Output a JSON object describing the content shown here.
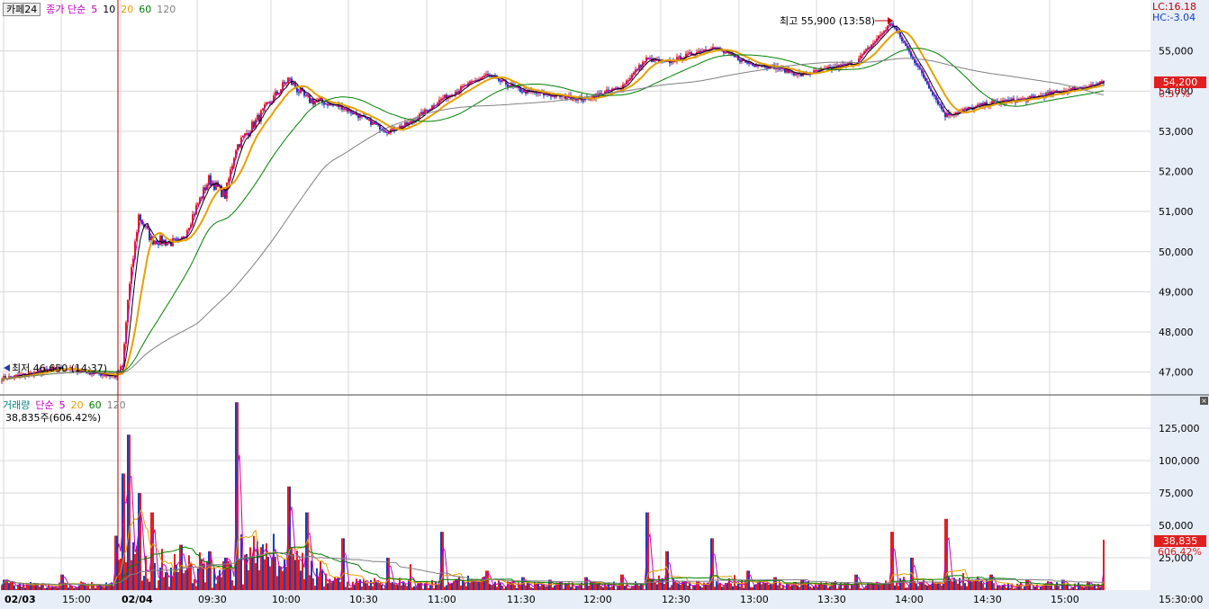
{
  "price_pane": {
    "symbol_tag": "카페24",
    "legend_prefix": "종가 단순",
    "ma_periods": [
      "5",
      "10",
      "20",
      "60",
      "120"
    ],
    "ma_colors": [
      "#c000c0",
      "#000000",
      "#e6a000",
      "#008000",
      "#808080"
    ],
    "lc_label": "LC:16.18",
    "hc_label": "HC:-3.04",
    "current_price": "54,200",
    "current_change": "0.37%",
    "high_annotation": "최고 55,900 (13:58)",
    "low_annotation": "최저 46,650 (14:37)"
  },
  "volume_pane": {
    "title": "거래량",
    "legend_prefix": "단순",
    "ma_periods": [
      "5",
      "20",
      "60",
      "120"
    ],
    "ma_colors": [
      "#c000c0",
      "#e6a000",
      "#008000",
      "#808080"
    ],
    "current_info": "38,835주(606.42%)",
    "current_volume": "38,835",
    "current_ratio": "606.42%",
    "close_icon": "close-icon"
  },
  "colors": {
    "up": "#e02020",
    "down": "#1040c0",
    "grid": "#d8d8d8",
    "axis_bg": "#e8eef8",
    "divider": "#b00000"
  },
  "x_axis": {
    "labels": [
      "02/03",
      "15:00",
      "02/04",
      "09:30",
      "10:00",
      "10:30",
      "11:00",
      "11:30",
      "12:00",
      "12:30",
      "13:00",
      "13:30",
      "14:00",
      "14:30",
      "15:00"
    ],
    "end_label": "15:30:00"
  },
  "chart_data": [
    {
      "type": "line",
      "description_series": "candlestick",
      "x": [
        "14:37",
        "15:00",
        "15:30",
        "09:00",
        "09:05",
        "09:10",
        "09:15",
        "09:20",
        "09:30",
        "09:40",
        "09:50",
        "10:00",
        "10:05",
        "10:15",
        "10:30",
        "10:45",
        "11:00",
        "11:15",
        "11:30",
        "11:45",
        "12:00",
        "12:15",
        "12:25",
        "12:35",
        "12:45",
        "13:00",
        "13:15",
        "13:30",
        "13:45",
        "13:58",
        "14:05",
        "14:15",
        "14:30",
        "14:45",
        "15:00",
        "15:20"
      ],
      "series": [
        {
          "name": "종가",
          "values": [
            46850,
            47100,
            46900,
            47100,
            48800,
            50900,
            50300,
            50200,
            51800,
            51400,
            52600,
            54300,
            53800,
            53600,
            53000,
            53200,
            53800,
            54400,
            54000,
            53900,
            53800,
            54100,
            54800,
            54700,
            55100,
            54700,
            54600,
            54400,
            54700,
            55700,
            54900,
            53400,
            53700,
            53800,
            54000,
            54200
          ]
        }
      ],
      "ylim": [
        46500,
        56200
      ],
      "y_ticks": [
        47000,
        48000,
        49000,
        50000,
        51000,
        52000,
        53000,
        54000,
        55000
      ]
    },
    {
      "type": "bar",
      "x": [
        "14:37",
        "15:00",
        "15:30",
        "09:00",
        "09:05",
        "09:10",
        "09:15",
        "09:20",
        "09:30",
        "09:40",
        "09:50",
        "10:00",
        "10:05",
        "10:15",
        "10:30",
        "10:45",
        "11:00",
        "11:15",
        "11:30",
        "11:45",
        "12:00",
        "12:15",
        "12:25",
        "12:35",
        "12:45",
        "13:00",
        "13:15",
        "13:30",
        "13:45",
        "13:58",
        "14:05",
        "14:15",
        "14:30",
        "14:45",
        "15:00",
        "15:20"
      ],
      "series": [
        {
          "name": "거래량",
          "values": [
            8000,
            12000,
            42000,
            90000,
            120000,
            75000,
            60000,
            35000,
            30000,
            25000,
            145000,
            80000,
            60000,
            40000,
            25000,
            20000,
            45000,
            15000,
            10000,
            8000,
            10000,
            12000,
            60000,
            30000,
            40000,
            15000,
            10000,
            8000,
            12000,
            45000,
            25000,
            55000,
            12000,
            8000,
            8000,
            38835
          ]
        }
      ],
      "ylim": [
        0,
        150000
      ],
      "y_ticks": [
        25000,
        50000,
        75000,
        100000,
        125000
      ]
    }
  ]
}
